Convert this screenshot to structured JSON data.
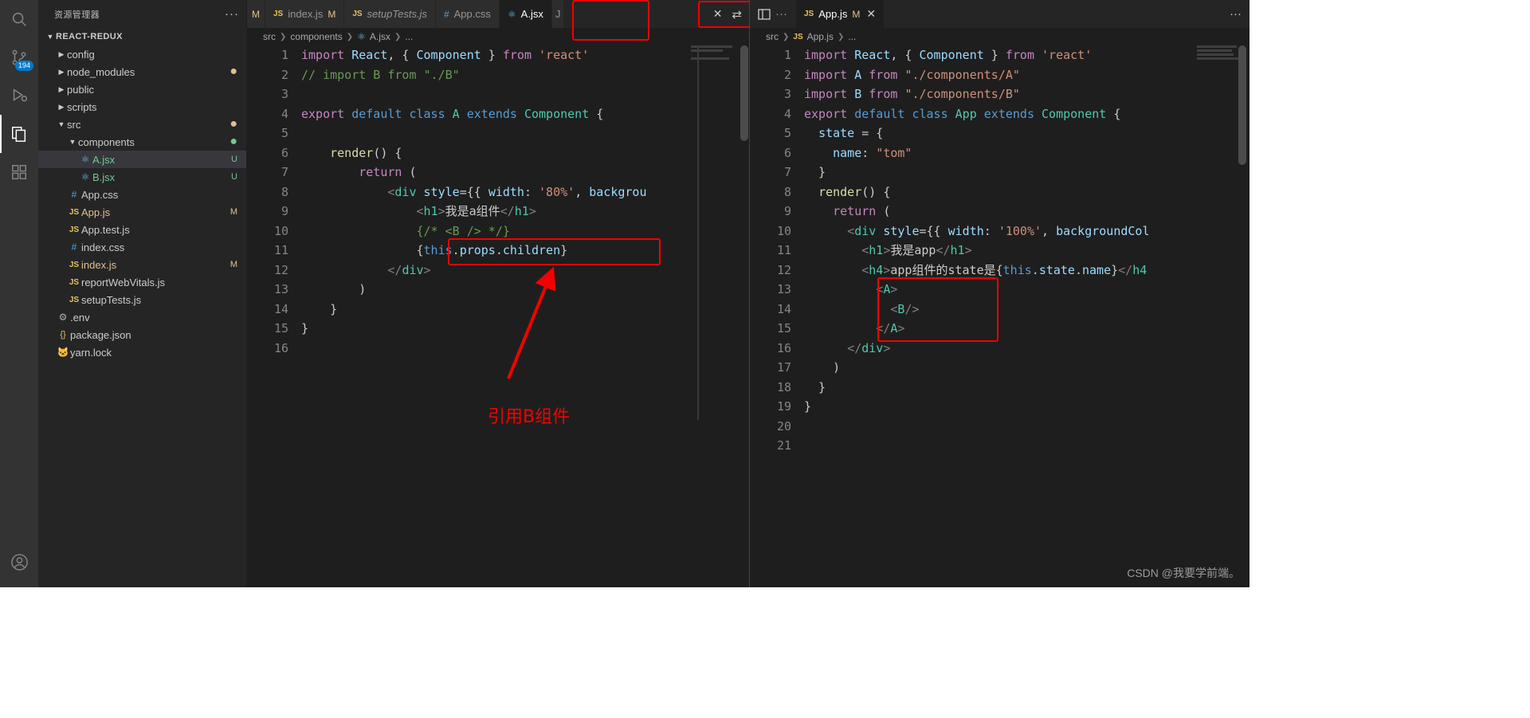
{
  "activitybar": {
    "items": [
      {
        "name": "search-icon",
        "glyph": "⌕",
        "badge": null,
        "active": false
      },
      {
        "name": "source-control-icon",
        "glyph": "⑂",
        "badge": "194",
        "active": false
      },
      {
        "name": "run-debug-icon",
        "glyph": "▷",
        "badge": null,
        "active": false
      },
      {
        "name": "explorer-icon",
        "glyph": "⧉",
        "badge": null,
        "active": true
      },
      {
        "name": "extensions-icon",
        "glyph": "⊞",
        "badge": null,
        "active": false
      }
    ],
    "account_icon": "account-icon"
  },
  "sidebar": {
    "title": "资源管理器",
    "more_actions": "···",
    "root": "REACT-REDUX",
    "items": [
      {
        "label": "config",
        "type": "folder",
        "indent": 1,
        "badge": "",
        "dot": ""
      },
      {
        "label": "node_modules",
        "type": "folder",
        "indent": 1,
        "badge": "",
        "dot": "amber"
      },
      {
        "label": "public",
        "type": "folder",
        "indent": 1,
        "badge": "",
        "dot": ""
      },
      {
        "label": "scripts",
        "type": "folder",
        "indent": 1,
        "badge": "",
        "dot": ""
      },
      {
        "label": "src",
        "type": "folder-open",
        "indent": 1,
        "badge": "",
        "dot": "amber"
      },
      {
        "label": "components",
        "type": "folder-open",
        "indent": 2,
        "badge": "",
        "dot": "green"
      },
      {
        "label": "A.jsx",
        "type": "react",
        "indent": 3,
        "badge": "U",
        "dot": "",
        "selected": true
      },
      {
        "label": "B.jsx",
        "type": "react",
        "indent": 3,
        "badge": "U",
        "dot": ""
      },
      {
        "label": "App.css",
        "type": "css",
        "indent": 2,
        "badge": "",
        "dot": ""
      },
      {
        "label": "App.js",
        "type": "js",
        "indent": 2,
        "badge": "M",
        "dot": ""
      },
      {
        "label": "App.test.js",
        "type": "js",
        "indent": 2,
        "badge": "",
        "dot": ""
      },
      {
        "label": "index.css",
        "type": "css",
        "indent": 2,
        "badge": "",
        "dot": ""
      },
      {
        "label": "index.js",
        "type": "js",
        "indent": 2,
        "badge": "M",
        "dot": ""
      },
      {
        "label": "reportWebVitals.js",
        "type": "js",
        "indent": 2,
        "badge": "",
        "dot": ""
      },
      {
        "label": "setupTests.js",
        "type": "js",
        "indent": 2,
        "badge": "",
        "dot": ""
      },
      {
        "label": ".env",
        "type": "gear",
        "indent": 1,
        "badge": "",
        "dot": ""
      },
      {
        "label": "package.json",
        "type": "json",
        "indent": 1,
        "badge": "",
        "dot": ""
      },
      {
        "label": "yarn.lock",
        "type": "yarn",
        "indent": 1,
        "badge": "",
        "dot": ""
      }
    ]
  },
  "left_group": {
    "tabs": [
      {
        "label": "M",
        "icon": "",
        "badge": "",
        "active": false,
        "italic": false,
        "partial": true
      },
      {
        "label": "index.js",
        "icon": "JS",
        "badge": "M",
        "active": false,
        "italic": false
      },
      {
        "label": "setupTests.js",
        "icon": "JS",
        "badge": "",
        "active": false,
        "italic": true
      },
      {
        "label": "App.css",
        "icon": "#",
        "badge": "",
        "active": false,
        "italic": false
      },
      {
        "label": "A.jsx",
        "icon": "react",
        "badge": "",
        "active": true,
        "italic": false
      },
      {
        "label": "J",
        "icon": "",
        "badge": "",
        "active": false,
        "italic": false,
        "partial": true
      }
    ],
    "close_label": "✕",
    "split_icon": "split-editor-icon",
    "breadcrumb": [
      "src",
      "components",
      "A.jsx",
      "..."
    ],
    "breadcrumb_icon": "react",
    "lines": [
      {
        "n": 1,
        "tokens": [
          {
            "t": "import",
            "c": "k"
          },
          {
            "t": " ",
            "c": "pu"
          },
          {
            "t": "React",
            "c": "id"
          },
          {
            "t": ", { ",
            "c": "pu"
          },
          {
            "t": "Component",
            "c": "id"
          },
          {
            "t": " } ",
            "c": "pu"
          },
          {
            "t": "from",
            "c": "k"
          },
          {
            "t": " ",
            "c": "pu"
          },
          {
            "t": "'react'",
            "c": "st"
          }
        ]
      },
      {
        "n": 2,
        "tokens": [
          {
            "t": "// import B from \"./B\"",
            "c": "cm"
          }
        ]
      },
      {
        "n": 3,
        "tokens": []
      },
      {
        "n": 4,
        "tokens": [
          {
            "t": "export",
            "c": "k"
          },
          {
            "t": " ",
            "c": "pu"
          },
          {
            "t": "default",
            "c": "kb"
          },
          {
            "t": " ",
            "c": "pu"
          },
          {
            "t": "class",
            "c": "kb"
          },
          {
            "t": " ",
            "c": "pu"
          },
          {
            "t": "A",
            "c": "ty"
          },
          {
            "t": " ",
            "c": "pu"
          },
          {
            "t": "extends",
            "c": "kb"
          },
          {
            "t": " ",
            "c": "pu"
          },
          {
            "t": "Component",
            "c": "ty"
          },
          {
            "t": " {",
            "c": "pu"
          }
        ]
      },
      {
        "n": 5,
        "tokens": []
      },
      {
        "n": 6,
        "tokens": [
          {
            "t": "    ",
            "c": "pu"
          },
          {
            "t": "render",
            "c": "fn"
          },
          {
            "t": "() {",
            "c": "pu"
          }
        ]
      },
      {
        "n": 7,
        "tokens": [
          {
            "t": "        ",
            "c": "pu"
          },
          {
            "t": "return",
            "c": "k"
          },
          {
            "t": " (",
            "c": "pu"
          }
        ]
      },
      {
        "n": 8,
        "tokens": [
          {
            "t": "            ",
            "c": "pu"
          },
          {
            "t": "<",
            "c": "tg"
          },
          {
            "t": "div",
            "c": "tn"
          },
          {
            "t": " ",
            "c": "pu"
          },
          {
            "t": "style",
            "c": "at"
          },
          {
            "t": "={{ ",
            "c": "pu"
          },
          {
            "t": "width",
            "c": "id"
          },
          {
            "t": ": ",
            "c": "pu"
          },
          {
            "t": "'80%'",
            "c": "st"
          },
          {
            "t": ", ",
            "c": "pu"
          },
          {
            "t": "backgrou",
            "c": "id"
          }
        ]
      },
      {
        "n": 9,
        "tokens": [
          {
            "t": "                ",
            "c": "pu"
          },
          {
            "t": "<",
            "c": "tg"
          },
          {
            "t": "h1",
            "c": "tn"
          },
          {
            "t": ">",
            "c": "tg"
          },
          {
            "t": "我是a组件",
            "c": "txt"
          },
          {
            "t": "</",
            "c": "tg"
          },
          {
            "t": "h1",
            "c": "tn"
          },
          {
            "t": ">",
            "c": "tg"
          }
        ]
      },
      {
        "n": 10,
        "tokens": [
          {
            "t": "                ",
            "c": "pu"
          },
          {
            "t": "{/* <B /> */}",
            "c": "cm"
          }
        ]
      },
      {
        "n": 11,
        "tokens": [
          {
            "t": "                ",
            "c": "pu"
          },
          {
            "t": "{",
            "c": "pu"
          },
          {
            "t": "this",
            "c": "kb"
          },
          {
            "t": ".",
            "c": "pu"
          },
          {
            "t": "props",
            "c": "id"
          },
          {
            "t": ".",
            "c": "pu"
          },
          {
            "t": "children",
            "c": "id"
          },
          {
            "t": "}",
            "c": "pu"
          }
        ]
      },
      {
        "n": 12,
        "tokens": [
          {
            "t": "            ",
            "c": "pu"
          },
          {
            "t": "</",
            "c": "tg"
          },
          {
            "t": "div",
            "c": "tn"
          },
          {
            "t": ">",
            "c": "tg"
          }
        ]
      },
      {
        "n": 13,
        "tokens": [
          {
            "t": "        )",
            "c": "pu"
          }
        ]
      },
      {
        "n": 14,
        "tokens": [
          {
            "t": "    }",
            "c": "pu"
          }
        ]
      },
      {
        "n": 15,
        "tokens": [
          {
            "t": "}",
            "c": "pu"
          }
        ]
      },
      {
        "n": 16,
        "tokens": []
      }
    ],
    "annotation": {
      "text": "引用B组件",
      "highlight_line": 11
    }
  },
  "right_group": {
    "toolbar": {
      "layout_icon": "editor-layout-icon",
      "more_icon": "···"
    },
    "tabs": [
      {
        "label": "App.js",
        "icon": "JS",
        "badge": "M",
        "active": true,
        "italic": false
      }
    ],
    "close_label": "✕",
    "breadcrumb": [
      "src",
      "App.js",
      "..."
    ],
    "breadcrumb_icon": "JS",
    "lines": [
      {
        "n": 1,
        "tokens": [
          {
            "t": "import",
            "c": "k"
          },
          {
            "t": " ",
            "c": "pu"
          },
          {
            "t": "React",
            "c": "id"
          },
          {
            "t": ", { ",
            "c": "pu"
          },
          {
            "t": "Component",
            "c": "id"
          },
          {
            "t": " } ",
            "c": "pu"
          },
          {
            "t": "from",
            "c": "k"
          },
          {
            "t": " ",
            "c": "pu"
          },
          {
            "t": "'react'",
            "c": "st"
          }
        ]
      },
      {
        "n": 2,
        "tokens": [
          {
            "t": "import",
            "c": "k"
          },
          {
            "t": " ",
            "c": "pu"
          },
          {
            "t": "A",
            "c": "id"
          },
          {
            "t": " ",
            "c": "pu"
          },
          {
            "t": "from",
            "c": "k"
          },
          {
            "t": " ",
            "c": "pu"
          },
          {
            "t": "\"./components/A\"",
            "c": "st"
          }
        ]
      },
      {
        "n": 3,
        "tokens": [
          {
            "t": "import",
            "c": "k"
          },
          {
            "t": " ",
            "c": "pu"
          },
          {
            "t": "B",
            "c": "id"
          },
          {
            "t": " ",
            "c": "pu"
          },
          {
            "t": "from",
            "c": "k"
          },
          {
            "t": " ",
            "c": "pu"
          },
          {
            "t": "\"./components/B\"",
            "c": "st"
          }
        ]
      },
      {
        "n": 4,
        "tokens": [
          {
            "t": "export",
            "c": "k"
          },
          {
            "t": " ",
            "c": "pu"
          },
          {
            "t": "default",
            "c": "kb"
          },
          {
            "t": " ",
            "c": "pu"
          },
          {
            "t": "class",
            "c": "kb"
          },
          {
            "t": " ",
            "c": "pu"
          },
          {
            "t": "App",
            "c": "ty"
          },
          {
            "t": " ",
            "c": "pu"
          },
          {
            "t": "extends",
            "c": "kb"
          },
          {
            "t": " ",
            "c": "pu"
          },
          {
            "t": "Component",
            "c": "ty"
          },
          {
            "t": " {",
            "c": "pu"
          }
        ]
      },
      {
        "n": 5,
        "tokens": [
          {
            "t": "  ",
            "c": "pu"
          },
          {
            "t": "state",
            "c": "id"
          },
          {
            "t": " = {",
            "c": "pu"
          }
        ]
      },
      {
        "n": 6,
        "tokens": [
          {
            "t": "    ",
            "c": "pu"
          },
          {
            "t": "name",
            "c": "id"
          },
          {
            "t": ": ",
            "c": "pu"
          },
          {
            "t": "\"tom\"",
            "c": "st"
          }
        ]
      },
      {
        "n": 7,
        "tokens": [
          {
            "t": "  }",
            "c": "pu"
          }
        ]
      },
      {
        "n": 8,
        "tokens": [
          {
            "t": "  ",
            "c": "pu"
          },
          {
            "t": "render",
            "c": "fn"
          },
          {
            "t": "() {",
            "c": "pu"
          }
        ]
      },
      {
        "n": 9,
        "tokens": [
          {
            "t": "    ",
            "c": "pu"
          },
          {
            "t": "return",
            "c": "k"
          },
          {
            "t": " (",
            "c": "pu"
          }
        ]
      },
      {
        "n": 10,
        "tokens": [
          {
            "t": "      ",
            "c": "pu"
          },
          {
            "t": "<",
            "c": "tg"
          },
          {
            "t": "div",
            "c": "tn"
          },
          {
            "t": " ",
            "c": "pu"
          },
          {
            "t": "style",
            "c": "at"
          },
          {
            "t": "={{ ",
            "c": "pu"
          },
          {
            "t": "width",
            "c": "id"
          },
          {
            "t": ": ",
            "c": "pu"
          },
          {
            "t": "'100%'",
            "c": "st"
          },
          {
            "t": ", ",
            "c": "pu"
          },
          {
            "t": "backgroundCol",
            "c": "id"
          }
        ]
      },
      {
        "n": 11,
        "tokens": [
          {
            "t": "        ",
            "c": "pu"
          },
          {
            "t": "<",
            "c": "tg"
          },
          {
            "t": "h1",
            "c": "tn"
          },
          {
            "t": ">",
            "c": "tg"
          },
          {
            "t": "我是app",
            "c": "txt"
          },
          {
            "t": "</",
            "c": "tg"
          },
          {
            "t": "h1",
            "c": "tn"
          },
          {
            "t": ">",
            "c": "tg"
          }
        ]
      },
      {
        "n": 12,
        "tokens": [
          {
            "t": "        ",
            "c": "pu"
          },
          {
            "t": "<",
            "c": "tg"
          },
          {
            "t": "h4",
            "c": "tn"
          },
          {
            "t": ">",
            "c": "tg"
          },
          {
            "t": "app组件的state是",
            "c": "txt"
          },
          {
            "t": "{",
            "c": "pu"
          },
          {
            "t": "this",
            "c": "kb"
          },
          {
            "t": ".",
            "c": "pu"
          },
          {
            "t": "state",
            "c": "id"
          },
          {
            "t": ".",
            "c": "pu"
          },
          {
            "t": "name",
            "c": "id"
          },
          {
            "t": "}",
            "c": "pu"
          },
          {
            "t": "</",
            "c": "tg"
          },
          {
            "t": "h4",
            "c": "tn"
          }
        ]
      },
      {
        "n": 13,
        "tokens": [
          {
            "t": "          ",
            "c": "pu"
          },
          {
            "t": "<",
            "c": "tg"
          },
          {
            "t": "A",
            "c": "tn"
          },
          {
            "t": ">",
            "c": "tg"
          }
        ]
      },
      {
        "n": 14,
        "tokens": [
          {
            "t": "            ",
            "c": "pu"
          },
          {
            "t": "<",
            "c": "tg"
          },
          {
            "t": "B",
            "c": "tn"
          },
          {
            "t": "/>",
            "c": "tg"
          }
        ]
      },
      {
        "n": 15,
        "tokens": [
          {
            "t": "          ",
            "c": "pu"
          },
          {
            "t": "</",
            "c": "tg"
          },
          {
            "t": "A",
            "c": "tn"
          },
          {
            "t": ">",
            "c": "tg"
          }
        ]
      },
      {
        "n": 16,
        "tokens": [
          {
            "t": "      ",
            "c": "pu"
          },
          {
            "t": "</",
            "c": "tg"
          },
          {
            "t": "div",
            "c": "tn"
          },
          {
            "t": ">",
            "c": "tg"
          }
        ]
      },
      {
        "n": 17,
        "tokens": [
          {
            "t": "    )",
            "c": "pu"
          }
        ]
      },
      {
        "n": 18,
        "tokens": [
          {
            "t": "  }",
            "c": "pu"
          }
        ]
      },
      {
        "n": 19,
        "tokens": [
          {
            "t": "}",
            "c": "pu"
          }
        ]
      },
      {
        "n": 20,
        "tokens": []
      },
      {
        "n": 21,
        "tokens": []
      }
    ]
  },
  "annotations": {
    "accent_color": "#f40000",
    "note_text": "引用B组件"
  },
  "watermark": "CSDN @我要学前端。"
}
